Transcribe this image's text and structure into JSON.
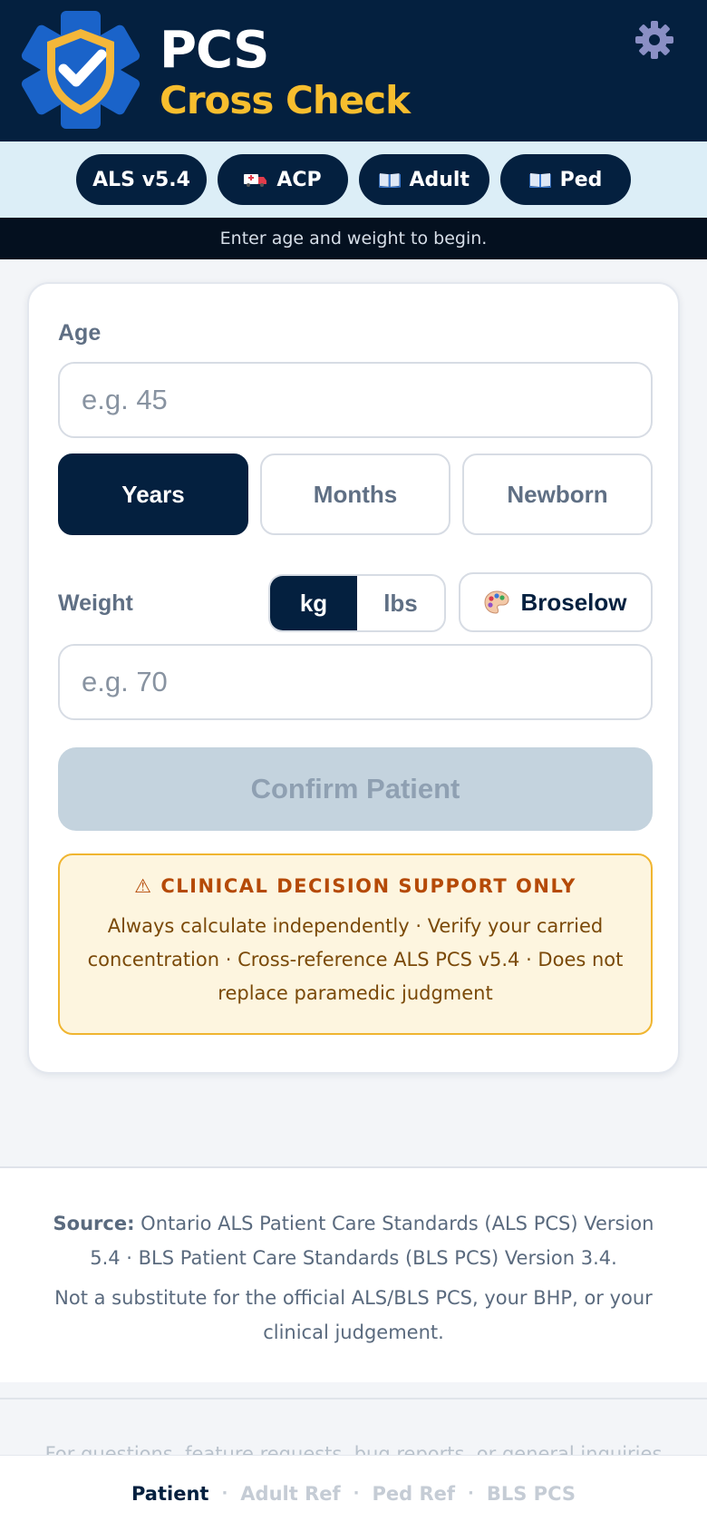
{
  "header": {
    "title_line1": "PCS",
    "title_line2": "Cross Check",
    "settings_icon": "gear-icon",
    "logo_icon": "shield-check-star-of-life-icon"
  },
  "chips": {
    "als": "ALS v5.4",
    "acp": "ACP",
    "adult": "Adult",
    "ped": "Ped"
  },
  "status": "Enter age and weight to begin.",
  "form": {
    "age_label": "Age",
    "age_placeholder": "e.g. 45",
    "age_value": "",
    "age_units": [
      "Years",
      "Months",
      "Newborn"
    ],
    "age_unit_selected": "Years",
    "weight_label": "Weight",
    "weight_units": [
      "kg",
      "lbs"
    ],
    "weight_unit_selected": "kg",
    "broselow_label": "Broselow",
    "weight_placeholder": "e.g. 70",
    "weight_value": "",
    "confirm_label": "Confirm Patient"
  },
  "warning": {
    "title": "⚠ CLINICAL DECISION SUPPORT ONLY",
    "body": "Always calculate independently · Verify your carried concentration · Cross-reference ALS PCS v5.4 · Does not replace paramedic judgment"
  },
  "footer": {
    "source_label": "Source:",
    "source_text": " Ontario ALS Patient Care Standards (ALS PCS) Version 5.4 · BLS Patient Care Standards (BLS PCS) Version 3.4.",
    "disclaimer": "Not a substitute for the official ALS/BLS PCS, your BHP, or your clinical judgement."
  },
  "faded_text": "For questions, feature requests, bug reports, or general inquiries",
  "bottom_nav": {
    "patient": "Patient",
    "adult_ref": "Adult Ref",
    "ped_ref": "Ped Ref",
    "bls_pcs": "BLS PCS",
    "separator": "·"
  },
  "colors": {
    "navy": "#04203f",
    "gold": "#f7be2e",
    "warning_border": "#f0b530",
    "warning_title": "#b54a07"
  }
}
